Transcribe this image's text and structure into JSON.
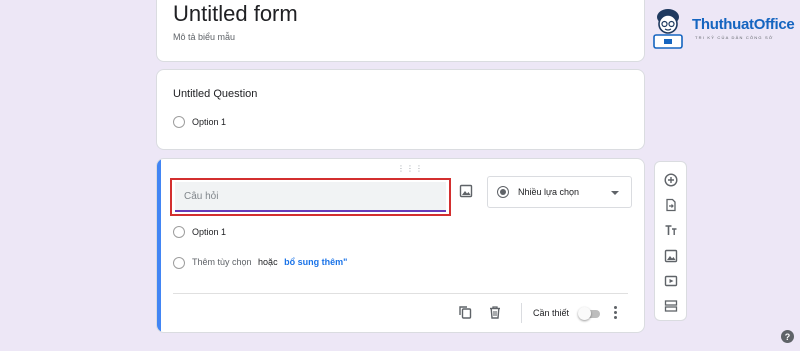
{
  "form": {
    "title": "Untitled form",
    "description": "Mô tả biểu mẫu"
  },
  "question1": {
    "title": "Untitled Question",
    "option": "Option 1"
  },
  "question2": {
    "placeholder": "Câu hỏi",
    "type": "Nhiều lựa chọn",
    "option": "Option 1",
    "add_option": "Thêm tùy chọn",
    "or": "hoặc",
    "add_other": "bổ sung thêm\"",
    "required": "Cần thiết",
    "drag_handle": "⋮⋮⋮"
  },
  "logo": {
    "name": "ThuthuatOffice",
    "tagline": "TRI KỶ CỦA DÂN CÔNG SỞ"
  },
  "help": {
    "label": "?"
  },
  "colors": {
    "background": "#ede7f6",
    "accent": "#4285f4",
    "input_underline": "#673ab7",
    "highlight_box": "#d32f2f",
    "link": "#1a73e8",
    "logo": "#1565c0"
  },
  "icons": {
    "image": "image-icon",
    "dropdown_radio": "radio-checked-icon",
    "copy": "copy-icon",
    "delete": "trash-icon",
    "more": "more-vert-icon",
    "toolbar": [
      "add-circle-icon",
      "import-icon",
      "title-text-icon",
      "image-icon",
      "video-icon",
      "section-icon"
    ]
  }
}
